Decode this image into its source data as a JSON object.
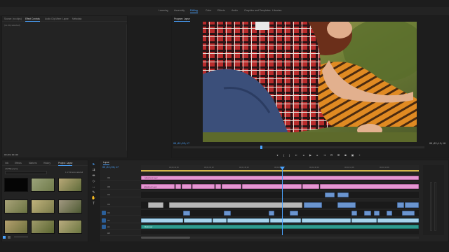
{
  "workspaces": [
    {
      "label": "Learning",
      "active": false
    },
    {
      "label": "Assembly",
      "active": false
    },
    {
      "label": "Editing",
      "active": true
    },
    {
      "label": "Color",
      "active": false
    },
    {
      "label": "Effects",
      "active": false
    },
    {
      "label": "Audio",
      "active": false
    },
    {
      "label": "Graphics and Templates",
      "active": false
    },
    {
      "label": "Libraries",
      "active": false
    }
  ],
  "source_panel": {
    "tabs": [
      "Source: (no clips)",
      "Effect Controls",
      "Audio Clip Mixer: Lapse",
      "Metadata"
    ],
    "active_tab": 1,
    "note": "(no clip selected)",
    "footer_tc": "00;00;00;00"
  },
  "program_panel": {
    "tab": "Program: Lapse",
    "current_tc": "00;02;03;17",
    "duration_tc": "00;03;12;18",
    "fit_label": "Fit",
    "quality_label": "Full"
  },
  "project_panel": {
    "tabs": [
      "Info",
      "Effects",
      "Markers",
      "History",
      "Project: Lapse"
    ],
    "active_tab": 4,
    "project_name": "LAPSE.prproj",
    "item_count": "1 of 19 items selected",
    "thumbnails": [
      {
        "label": "Black Video",
        "dur": "5;00"
      },
      {
        "label": "Clip 01",
        "dur": "8;12"
      },
      {
        "label": "Clip 02",
        "dur": "6;20"
      },
      {
        "label": "Clip 03",
        "dur": "4;15"
      },
      {
        "label": "Clip 04",
        "dur": "7;02"
      },
      {
        "label": "Clip 05",
        "dur": "5;18"
      },
      {
        "label": "Clip 06",
        "dur": "6;08"
      },
      {
        "label": "Clip 07",
        "dur": "9;11"
      },
      {
        "label": "Clip 08",
        "dur": "3;24"
      }
    ]
  },
  "timeline": {
    "tab": "Lapse",
    "current_tc": "00;02;03;17",
    "ruler_ticks": [
      "00;00;32;00",
      "00;01;04;02",
      "00;01;36;02",
      "00;02;08;04",
      "00;02;40;04",
      "00;03;12;06",
      "00;03;44;06"
    ],
    "tracks": [
      {
        "label": "V6"
      },
      {
        "label": "V5"
      },
      {
        "label": "V4"
      },
      {
        "label": "V3"
      },
      {
        "label": "V2"
      },
      {
        "label": "V1"
      },
      {
        "label": "A1"
      },
      {
        "label": "A2"
      }
    ],
    "clip_label_pink": "Adjustment Layer",
    "clip_label_audio": "Music.wav"
  },
  "colors": {
    "accent": "#4aa3ff",
    "clip_pink": "#e596d2",
    "clip_blue": "#8fb6e6",
    "clip_audio": "#2f9b8f"
  }
}
